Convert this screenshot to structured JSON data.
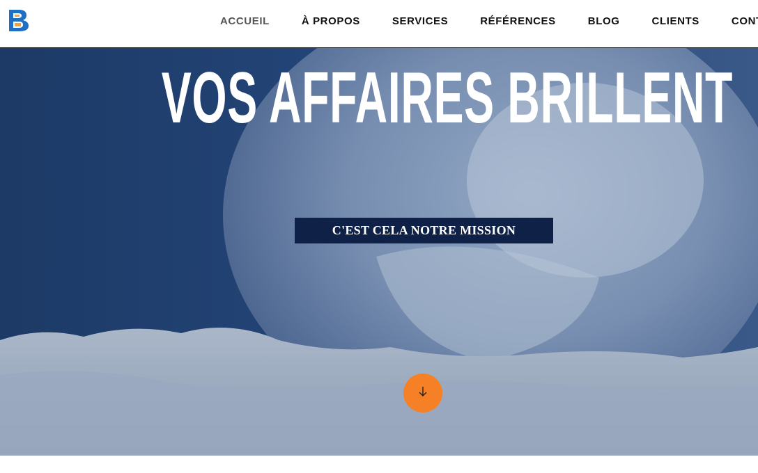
{
  "header": {
    "logo_icon": "b-logo-icon",
    "nav": [
      {
        "label": "ACCUEIL",
        "active": true
      },
      {
        "label": "À PROPOS"
      },
      {
        "label": "SERVICES"
      },
      {
        "label": "RÉFÉRENCES"
      },
      {
        "label": "BLOG"
      },
      {
        "label": "CLIENTS"
      },
      {
        "label": "CONTACT"
      }
    ]
  },
  "hero": {
    "title": "VOS AFFAIRES BRILLENT",
    "subtitle": "C'EST CELA NOTRE MISSION",
    "scroll_icon": "arrow-down-icon",
    "background": "frozen-bubble-on-snow-image"
  },
  "colors": {
    "hero_blue": "#1c3b68",
    "mission_box": "#0f2147",
    "accent_orange": "#f58025",
    "logo_blue": "#1f6fc4",
    "logo_orange": "#f5a13a"
  }
}
